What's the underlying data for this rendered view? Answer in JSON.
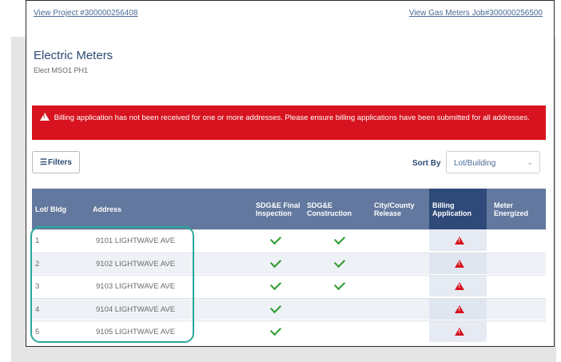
{
  "links": {
    "project": "View Project #300000256408",
    "gas_meters": "View Gas Meters Job#300000256500"
  },
  "page": {
    "title": "Electric Meters",
    "subtitle": "Elect MSO1 PH1"
  },
  "alert": {
    "message": "Billing application has not been received for one or more addresses. Please ensure billing applications have been submitted for all addresses.",
    "icon": "warning-icon",
    "color": "#d7131f"
  },
  "toolbar": {
    "filters_label": "Filters",
    "sort_label": "Sort By",
    "sort_value": "Lot/Building"
  },
  "table": {
    "headers": {
      "lot": "Lot/ Bldg",
      "address": "Address",
      "final_inspection": "SDG&E Final Inspection",
      "construction": "SDG&E Construction",
      "city_release": "City/County Release",
      "billing": "Billing Application",
      "meter": "Meter Energized"
    },
    "rows": [
      {
        "lot": "1",
        "address": "9101 LIGHTWAVE AVE",
        "final_inspection": true,
        "construction": true,
        "city_release": false,
        "billing_warning": true,
        "meter": false
      },
      {
        "lot": "2",
        "address": "9102 LIGHTWAVE AVE",
        "final_inspection": true,
        "construction": true,
        "city_release": false,
        "billing_warning": true,
        "meter": false
      },
      {
        "lot": "3",
        "address": "9103 LIGHTWAVE AVE",
        "final_inspection": true,
        "construction": true,
        "city_release": false,
        "billing_warning": true,
        "meter": false
      },
      {
        "lot": "4",
        "address": "9104 LIGHTWAVE AVE",
        "final_inspection": true,
        "construction": false,
        "city_release": false,
        "billing_warning": true,
        "meter": false
      },
      {
        "lot": "5",
        "address": "9105 LIGHTWAVE AVE",
        "final_inspection": true,
        "construction": false,
        "city_release": false,
        "billing_warning": true,
        "meter": false
      }
    ]
  },
  "colors": {
    "header_bg": "#63789e",
    "billing_header_bg": "#2f4979",
    "check": "#2e9a2e",
    "highlight": "#27a89a"
  }
}
